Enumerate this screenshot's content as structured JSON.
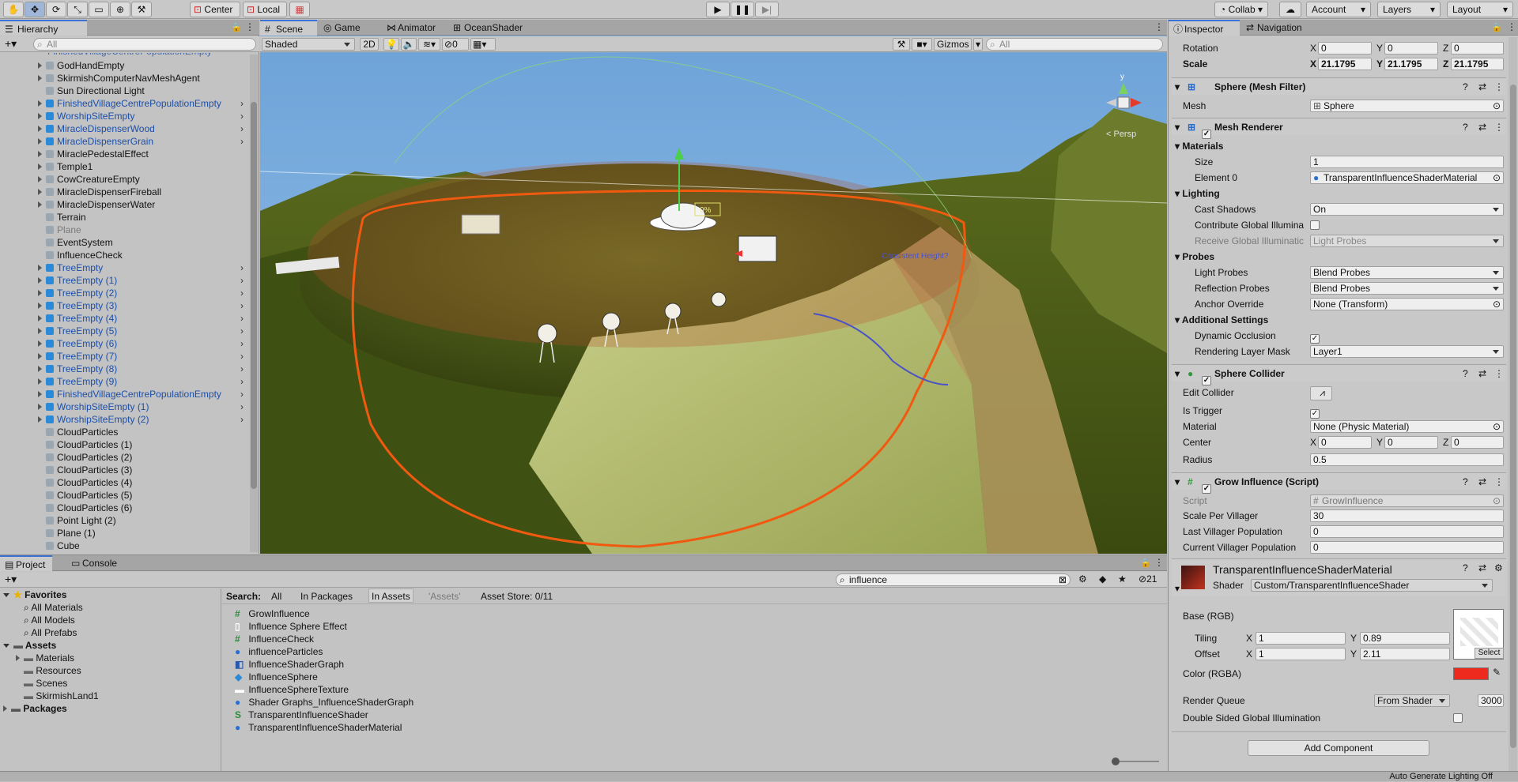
{
  "toolbar": {
    "center_label": "Center",
    "local_label": "Local",
    "collab_label": "Collab",
    "account_label": "Account",
    "layers_label": "Layers",
    "layout_label": "Layout"
  },
  "hierarchy": {
    "tab_label": "Hierarchy",
    "search_placeholder": "All",
    "items": [
      {
        "label": "GodHandEmpty",
        "style": "normal",
        "expand": true,
        "prefab": false
      },
      {
        "label": "SkirmishComputerNavMeshAgent",
        "style": "normal",
        "expand": true,
        "prefab": false
      },
      {
        "label": "Sun Directional Light",
        "style": "normal",
        "expand": false,
        "prefab": false
      },
      {
        "label": "FinishedVillageCentrePopulationEmpty",
        "style": "blue",
        "expand": true,
        "prefab": true
      },
      {
        "label": "WorshipSiteEmpty",
        "style": "blue",
        "expand": true,
        "prefab": true
      },
      {
        "label": "MiracleDispenserWood",
        "style": "blue",
        "expand": true,
        "prefab": true
      },
      {
        "label": "MiracleDispenserGrain",
        "style": "blue",
        "expand": true,
        "prefab": true
      },
      {
        "label": "MiraclePedestalEffect",
        "style": "normal",
        "expand": true,
        "prefab": false
      },
      {
        "label": "Temple1",
        "style": "normal",
        "expand": true,
        "prefab": false
      },
      {
        "label": "CowCreatureEmpty",
        "style": "normal",
        "expand": true,
        "prefab": false
      },
      {
        "label": "MiracleDispenserFireball",
        "style": "normal",
        "expand": true,
        "prefab": false
      },
      {
        "label": "MiracleDispenserWater",
        "style": "normal",
        "expand": true,
        "prefab": false
      },
      {
        "label": "Terrain",
        "style": "normal",
        "expand": false,
        "prefab": false
      },
      {
        "label": "Plane",
        "style": "gray",
        "expand": false,
        "prefab": false
      },
      {
        "label": "EventSystem",
        "style": "normal",
        "expand": false,
        "prefab": false
      },
      {
        "label": "InfluenceCheck",
        "style": "normal",
        "expand": false,
        "prefab": false
      },
      {
        "label": "TreeEmpty",
        "style": "blue",
        "expand": true,
        "prefab": true
      },
      {
        "label": "TreeEmpty (1)",
        "style": "blue",
        "expand": true,
        "prefab": true
      },
      {
        "label": "TreeEmpty (2)",
        "style": "blue",
        "expand": true,
        "prefab": true
      },
      {
        "label": "TreeEmpty (3)",
        "style": "blue",
        "expand": true,
        "prefab": true
      },
      {
        "label": "TreeEmpty (4)",
        "style": "blue",
        "expand": true,
        "prefab": true
      },
      {
        "label": "TreeEmpty (5)",
        "style": "blue",
        "expand": true,
        "prefab": true
      },
      {
        "label": "TreeEmpty (6)",
        "style": "blue",
        "expand": true,
        "prefab": true
      },
      {
        "label": "TreeEmpty (7)",
        "style": "blue",
        "expand": true,
        "prefab": true
      },
      {
        "label": "TreeEmpty (8)",
        "style": "blue",
        "expand": true,
        "prefab": true
      },
      {
        "label": "TreeEmpty (9)",
        "style": "blue",
        "expand": true,
        "prefab": true
      },
      {
        "label": "FinishedVillageCentrePopulationEmpty",
        "style": "blue",
        "expand": true,
        "prefab": true
      },
      {
        "label": "WorshipSiteEmpty (1)",
        "style": "blue",
        "expand": true,
        "prefab": true
      },
      {
        "label": "WorshipSiteEmpty (2)",
        "style": "blue",
        "expand": true,
        "prefab": true
      },
      {
        "label": "CloudParticles",
        "style": "normal",
        "expand": false,
        "prefab": false
      },
      {
        "label": "CloudParticles (1)",
        "style": "normal",
        "expand": false,
        "prefab": false
      },
      {
        "label": "CloudParticles (2)",
        "style": "normal",
        "expand": false,
        "prefab": false
      },
      {
        "label": "CloudParticles (3)",
        "style": "normal",
        "expand": false,
        "prefab": false
      },
      {
        "label": "CloudParticles (4)",
        "style": "normal",
        "expand": false,
        "prefab": false
      },
      {
        "label": "CloudParticles (5)",
        "style": "normal",
        "expand": false,
        "prefab": false
      },
      {
        "label": "CloudParticles (6)",
        "style": "normal",
        "expand": false,
        "prefab": false
      },
      {
        "label": "Point Light (2)",
        "style": "normal",
        "expand": false,
        "prefab": false
      },
      {
        "label": "Plane (1)",
        "style": "normal",
        "expand": false,
        "prefab": false
      },
      {
        "label": "Cube",
        "style": "normal",
        "expand": false,
        "prefab": false
      }
    ]
  },
  "scene": {
    "tabs": [
      "Scene",
      "Game",
      "Animator",
      "OceanShader"
    ],
    "shading_mode": "Shaded",
    "mode_2d": "2D",
    "fx_count": "0",
    "gizmos_label": "Gizmos",
    "search_placeholder": "All",
    "persp_label": "< Persp",
    "annotation": "Consistent Height?",
    "percent_label": "0%"
  },
  "project": {
    "tabs": [
      "Project",
      "Console"
    ],
    "search_value": "influence",
    "hidden_count": "21",
    "favorites_label": "Favorites",
    "favorites": [
      "All Materials",
      "All Models",
      "All Prefabs"
    ],
    "assets_label": "Assets",
    "asset_folders": [
      "Materials",
      "Resources",
      "Scenes",
      "SkirmishLand1"
    ],
    "packages_label": "Packages",
    "search_label": "Search:",
    "filters": [
      "All",
      "In Packages",
      "In Assets",
      "'Assets'",
      "Asset Store: 0/11"
    ],
    "results": [
      {
        "label": "GrowInfluence",
        "icon": "script-icon"
      },
      {
        "label": "Influence Sphere Effect",
        "icon": "blank-icon"
      },
      {
        "label": "InfluenceCheck",
        "icon": "script-icon"
      },
      {
        "label": "influenceParticles",
        "icon": "sphere-icon"
      },
      {
        "label": "InfluenceShaderGraph",
        "icon": "shadergraph-icon"
      },
      {
        "label": "InfluenceSphere",
        "icon": "prefab-icon"
      },
      {
        "label": "InfluenceSphereTexture",
        "icon": "texture-icon"
      },
      {
        "label": "Shader Graphs_InfluenceShaderGraph",
        "icon": "sphere-icon"
      },
      {
        "label": "TransparentInfluenceShader",
        "icon": "shader-icon"
      },
      {
        "label": "TransparentInfluenceShaderMaterial",
        "icon": "sphere-icon"
      }
    ]
  },
  "inspector": {
    "tabs": [
      "Inspector",
      "Navigation"
    ],
    "rotation": {
      "label": "Rotation",
      "x": "0",
      "y": "0",
      "z": "0"
    },
    "scale": {
      "label": "Scale",
      "x": "21.1795",
      "y": "21.1795",
      "z": "21.1795"
    },
    "mesh_filter": {
      "title": "Sphere (Mesh Filter)",
      "mesh_label": "Mesh",
      "mesh_value": "Sphere"
    },
    "mesh_renderer": {
      "title": "Mesh Renderer",
      "materials_label": "Materials",
      "size_label": "Size",
      "size_value": "1",
      "element_label": "Element 0",
      "element_value": "TransparentInfluenceShaderMaterial",
      "lighting_label": "Lighting",
      "cast_shadows_label": "Cast Shadows",
      "cast_shadows_value": "On",
      "contribute_gi_label": "Contribute Global Illumina",
      "receive_gi_label": "Receive Global Illuminatic",
      "receive_gi_value": "Light Probes",
      "probes_label": "Probes",
      "light_probes_label": "Light Probes",
      "light_probes_value": "Blend Probes",
      "reflection_probes_label": "Reflection Probes",
      "reflection_probes_value": "Blend Probes",
      "anchor_override_label": "Anchor Override",
      "anchor_override_value": "None (Transform)",
      "additional_label": "Additional Settings",
      "dynamic_occlusion_label": "Dynamic Occlusion",
      "rendering_layer_label": "Rendering Layer Mask",
      "rendering_layer_value": "Layer1"
    },
    "sphere_collider": {
      "title": "Sphere Collider",
      "edit_collider_label": "Edit Collider",
      "is_trigger_label": "Is Trigger",
      "material_label": "Material",
      "material_value": "None (Physic Material)",
      "center_label": "Center",
      "center_x": "0",
      "center_y": "0",
      "center_z": "0",
      "radius_label": "Radius",
      "radius_value": "0.5"
    },
    "grow_influence": {
      "title": "Grow Influence (Script)",
      "script_label": "Script",
      "script_value": "GrowInfluence",
      "scale_per_villager_label": "Scale Per Villager",
      "scale_per_villager_value": "30",
      "last_pop_label": "Last Villager Population",
      "last_pop_value": "0",
      "current_pop_label": "Current Villager Population",
      "current_pop_value": "0"
    },
    "material": {
      "name": "TransparentInfluenceShaderMaterial",
      "shader_label": "Shader",
      "shader_value": "Custom/TransparentInfluenceShader",
      "base_label": "Base (RGB)",
      "tiling_label": "Tiling",
      "tiling_x": "1",
      "tiling_y": "0.89",
      "offset_label": "Offset",
      "offset_x": "1",
      "offset_y": "2.11",
      "select_label": "Select",
      "color_label": "Color (RGBA)",
      "color_value": "#ee2a1e",
      "render_queue_label": "Render Queue",
      "render_queue_mode": "From Shader",
      "render_queue_value": "3000",
      "double_sided_label": "Double Sided Global Illumination"
    },
    "add_component_label": "Add Component"
  },
  "status": {
    "text": "Auto Generate Lighting Off"
  }
}
